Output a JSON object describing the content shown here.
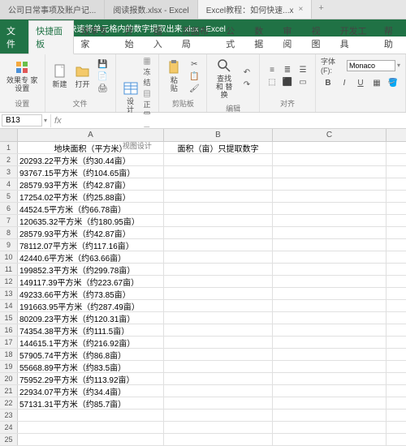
{
  "titleTabs": [
    {
      "label": "公司日常事项及账户记...",
      "active": false
    },
    {
      "label": "阅读报数.xlsx - Excel",
      "active": false
    },
    {
      "label": "Excel教程：如何快速...x",
      "active": true
    }
  ],
  "subtitle": "Excel教程：如何快速将单元格内的数字提取出来.xlsx - Excel",
  "ribbonTabs": {
    "file": "文件",
    "items": [
      "快捷面板",
      "效率专家",
      "开始",
      "插入",
      "页面布局",
      "公式",
      "数据",
      "审阅",
      "视图",
      "开发工具",
      "帮助"
    ],
    "activeIndex": 0
  },
  "ribbon": {
    "groups": {
      "settings": {
        "btn": "效果专\n家设置",
        "label": "设置"
      },
      "files": {
        "btns": [
          "新建",
          "打开"
        ],
        "label": "文件"
      },
      "design": {
        "btn": "设\n计",
        "label": "视图设计"
      },
      "paste": {
        "btn": "粘\n贴",
        "label": "剪贴板",
        "side": [
          "冻结",
          "正常"
        ]
      },
      "edit": {
        "btn": "查找和\n替换",
        "label": "编辑"
      },
      "chart": {
        "label": "对齐"
      },
      "font": {
        "label": "字体(F):",
        "name": "Monaco"
      }
    }
  },
  "nameBox": "B13",
  "columns": [
    "A",
    "B",
    "C"
  ],
  "headers": [
    "地块面积（平方米）",
    "面积（亩）只提取数字"
  ],
  "rows": [
    "20293.22平方米（约30.44亩）",
    "93767.15平方米（约104.65亩）",
    "28579.93平方米（约42.87亩）",
    "17254.02平方米（约25.88亩）",
    "44524.5平方米（约66.78亩）",
    "120635.32平方米（约180.95亩）",
    "28579.93平方米（约42.87亩）",
    "78112.07平方米（约117.16亩）",
    "42440.6平方米（约63.66亩）",
    "199852.3平方米（约299.78亩）",
    "149117.39平方米（约223.67亩）",
    "49233.66平方米（约73.85亩）",
    "191663.95平方米（约287.49亩）",
    "80209.23平方米（约120.31亩）",
    "74354.38平方米（约111.5亩）",
    "144615.1平方米（约216.92亩）",
    "57905.74平方米（约86.8亩）",
    "55668.89平方米（约83.5亩）",
    "75952.29平方米（约113.92亩）",
    "22934.07平方米（约34.4亩）",
    "57131.31平方米（约85.7亩）"
  ],
  "emptyRows": [
    23,
    24,
    25
  ]
}
